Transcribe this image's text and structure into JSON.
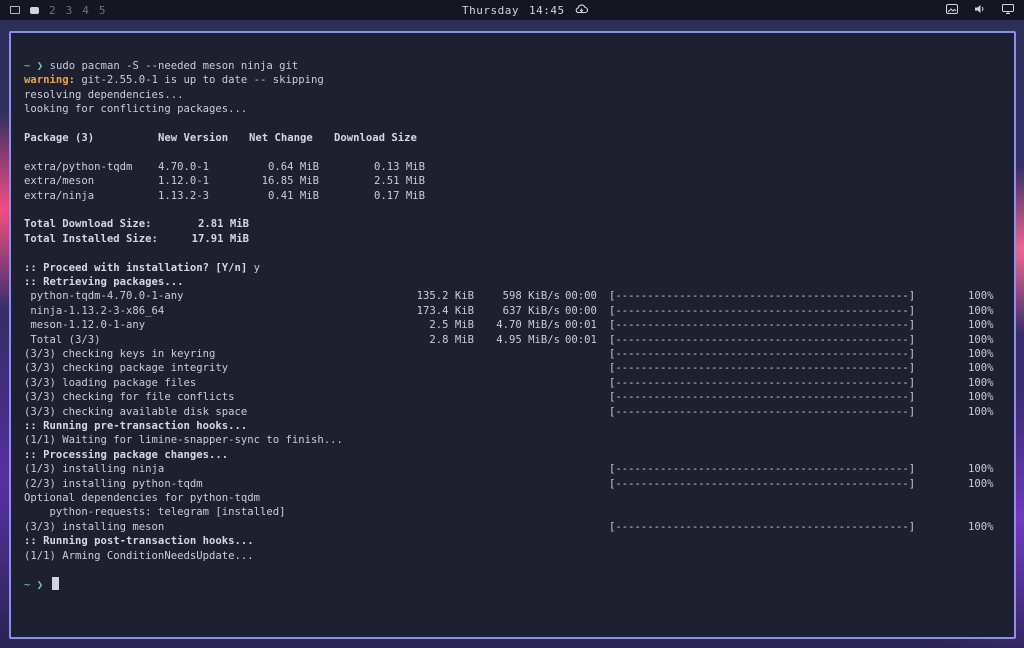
{
  "topbar": {
    "workspaces": [
      "2",
      "3",
      "4",
      "5"
    ],
    "clock_day": "Thursday",
    "clock_time": "14:45"
  },
  "terminal": {
    "prompt_symbol": "~",
    "prompt_arrow": "❯",
    "command": "sudo pacman -S --needed meson ninja git",
    "warning_label": "warning:",
    "warning_text": " git-2.55.0-1 is up to date -- skipping",
    "resolving": "resolving dependencies...",
    "conflicts": "looking for conflicting packages...",
    "table_header": {
      "package": "Package (3)",
      "new_version": "New Version",
      "net_change": "Net Change",
      "download_size": "Download Size"
    },
    "packages": [
      {
        "name": "extra/python-tqdm",
        "version": "4.70.0-1",
        "net": "0.64 MiB",
        "download": "0.13 MiB"
      },
      {
        "name": "extra/meson",
        "version": "1.12.0-1",
        "net": "16.85 MiB",
        "download": "2.51 MiB"
      },
      {
        "name": "extra/ninja",
        "version": "1.13.2-3",
        "net": "0.41 MiB",
        "download": "0.17 MiB"
      }
    ],
    "total_download_label": "Total Download Size:",
    "total_download_value": "2.81 MiB",
    "total_installed_label": "Total Installed Size:",
    "total_installed_value": "17.91 MiB",
    "proceed": ":: Proceed with installation? [Y/n]",
    "proceed_answer": "y",
    "retrieving": ":: Retrieving packages...",
    "downloads": [
      {
        "name": " python-tqdm-4.70.0-1-any",
        "size": "135.2 KiB",
        "rate": "598 KiB/s",
        "time": "00:00"
      },
      {
        "name": " ninja-1.13.2-3-x86_64",
        "size": "173.4 KiB",
        "rate": "637 KiB/s",
        "time": "00:00"
      },
      {
        "name": " meson-1.12.0-1-any",
        "size": "2.5 MiB",
        "rate": "4.70 MiB/s",
        "time": "00:01"
      },
      {
        "name": " Total (3/3)",
        "size": "2.8 MiB",
        "rate": "4.95 MiB/s",
        "time": "00:01"
      }
    ],
    "progress_bar": "[----------------------------------------------]",
    "progress_percent": "100%",
    "checks": [
      "(3/3) checking keys in keyring",
      "(3/3) checking package integrity",
      "(3/3) loading package files",
      "(3/3) checking for file conflicts",
      "(3/3) checking available disk space"
    ],
    "pre_hooks": ":: Running pre-transaction hooks...",
    "pre_hook_1": "(1/1) Waiting for limine-snapper-sync to finish...",
    "processing": ":: Processing package changes...",
    "install_1": "(1/3) installing ninja",
    "install_2": "(2/3) installing python-tqdm",
    "optional_deps": "Optional dependencies for python-tqdm",
    "optional_dep_1": "    python-requests: telegram [installed]",
    "install_3": "(3/3) installing meson",
    "post_hooks": ":: Running post-transaction hooks...",
    "post_hook_1": "(1/1) Arming ConditionNeedsUpdate..."
  }
}
